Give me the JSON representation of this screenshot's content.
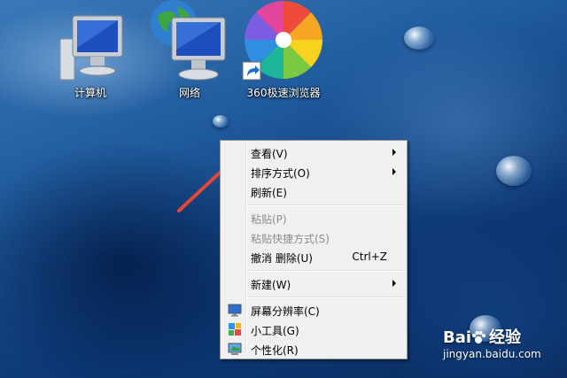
{
  "desktop": {
    "icons": [
      {
        "label": "计算机",
        "icon": "computer-icon"
      },
      {
        "label": "网络",
        "icon": "network-icon"
      },
      {
        "label": "360极速浏览器",
        "icon": "360-browser-icon"
      }
    ]
  },
  "context_menu": {
    "items": [
      {
        "label": "查看(V)",
        "submenu": true
      },
      {
        "label": "排序方式(O)",
        "submenu": true
      },
      {
        "label": "刷新(E)"
      },
      {
        "label": "粘贴(P)",
        "disabled": true
      },
      {
        "label": "粘贴快捷方式(S)",
        "disabled": true
      },
      {
        "label": "撤消 删除(U)",
        "shortcut": "Ctrl+Z"
      },
      {
        "label": "新建(W)",
        "submenu": true
      },
      {
        "label": "屏幕分辨率(C)",
        "icon": "display-icon"
      },
      {
        "label": "小工具(G)",
        "icon": "gadgets-icon"
      },
      {
        "label": "个性化(R)",
        "icon": "personalize-icon"
      }
    ]
  },
  "watermark": {
    "brand_a": "Bai",
    "brand_b": "经验",
    "url": "jingyan.baidu.com"
  },
  "colors": {
    "annotation_arrow": "#e8443a",
    "menu_background": "#f0f0f0"
  }
}
